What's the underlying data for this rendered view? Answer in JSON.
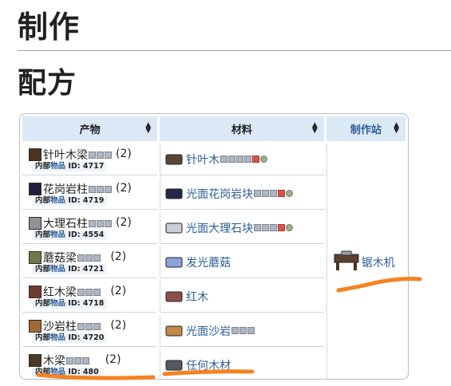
{
  "headings": {
    "h1": "制作",
    "h2": "配方"
  },
  "table": {
    "headers": {
      "product": "产物",
      "materials": "材料",
      "station": "制作站"
    },
    "id_prefix_a": "内部",
    "id_prefix_b": "物品",
    "id_prefix_c": " ID: ",
    "rows": [
      {
        "product": "针叶木梁",
        "id": "4717",
        "count": "(2)",
        "product_color": "#4a3320",
        "material": "针叶木",
        "material_color": "#5b4636",
        "plats": [
          "pc",
          "pad",
          "char",
          "mob",
          "red",
          "gear"
        ]
      },
      {
        "product": "花岗岩柱",
        "id": "4719",
        "count": "(2)",
        "product_color": "#1d2040",
        "material": "光面花岗岩块",
        "material_color": "#242848",
        "plats": [
          "pc",
          "pad",
          "mob",
          "red",
          "gear"
        ]
      },
      {
        "product": "大理石柱",
        "id": "4554",
        "count": "(2)",
        "product_color": "#8c939c",
        "material": "光面大理石块",
        "material_color": "#c8ced6",
        "plats": [
          "pc",
          "pad",
          "mob",
          "red",
          "gear"
        ]
      },
      {
        "product": "蘑菇梁",
        "id": "4721",
        "count": "(2)",
        "product_color": "#6d7a4b",
        "material": "发光蘑菇",
        "material_color": "#8aa4d8",
        "plats": []
      },
      {
        "product": "红木梁",
        "id": "4718",
        "count": "(2)",
        "product_color": "#6e3b35",
        "material": "红木",
        "material_color": "#8a4f4a",
        "plats": []
      },
      {
        "product": "沙岩柱",
        "id": "4720",
        "count": "(2)",
        "product_color": "#9c6a3a",
        "material": "光面沙岩",
        "material_color": "#c08a4a",
        "plats": [
          "pc",
          "pad",
          "mob"
        ]
      },
      {
        "product": "木梁",
        "id": "480",
        "count": "(2)",
        "product_color": "#4b3a2a",
        "material": "任何木材",
        "material_color": "#55595f",
        "plats": []
      }
    ],
    "station": {
      "label": "锯木机",
      "icon": "sawmill-icon"
    }
  },
  "annotation_color": "#f58220"
}
